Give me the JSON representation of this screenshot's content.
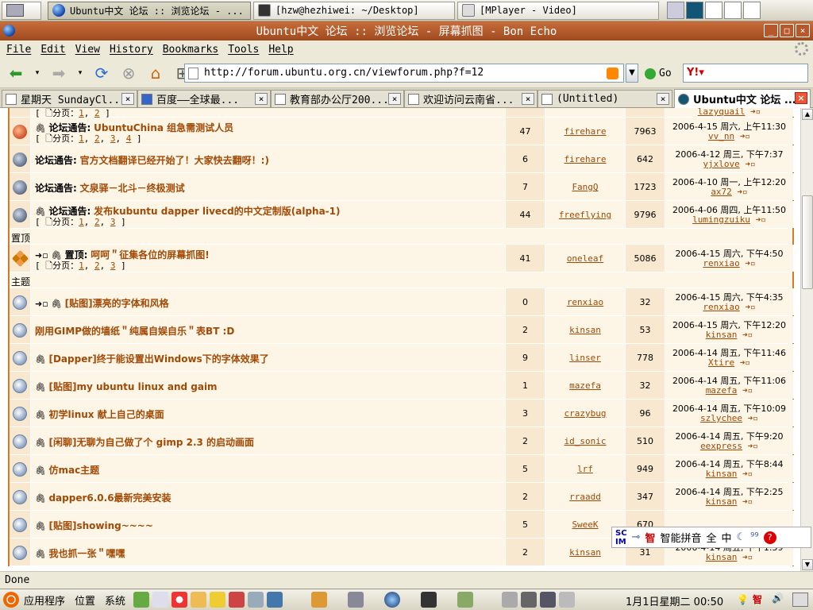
{
  "taskbar_top": {
    "windows": [
      "Ubuntu中文 论坛 :: 浏览论坛 - ...",
      "[hzw@hezhiwei: ~/Desktop]",
      "[MPlayer - Video]"
    ]
  },
  "window": {
    "title": "Ubuntu中文 论坛 :: 浏览论坛 - 屏幕抓图 - Bon Echo"
  },
  "menu": {
    "file": "File",
    "edit": "Edit",
    "view": "View",
    "history": "History",
    "bookmarks": "Bookmarks",
    "tools": "Tools",
    "help": "Help"
  },
  "nav": {
    "url": "http://forum.ubuntu.org.cn/viewforum.php?f=12",
    "go": "Go"
  },
  "tabs": [
    "星期天 SundayCl...",
    "百度——全球最...",
    "教育部办公厅200...",
    "欢迎访问云南省...",
    "(Untitled)",
    "Ubuntu中文 论坛 ..."
  ],
  "labels": {
    "page_prefix": "分页：",
    "sticky_header": "置顶",
    "topic_header": "主题"
  },
  "rows": [
    {
      "kind": "announce",
      "icon": "hot",
      "pre": "论坛通告:",
      "title": "UbuntuChina 组急需测试人员",
      "pages": [
        "1",
        "2",
        "3",
        "4"
      ],
      "replies": "47",
      "author": "firehare",
      "views": "7963",
      "last_date": "2006-4-15 周六, 上午11:30",
      "last_user": "vv_nn"
    },
    {
      "kind": "announce",
      "icon": "globe",
      "pre": "论坛通告:",
      "title": "官方文档翻译已经开始了！大家快去翻呀！:)",
      "pages": [],
      "replies": "6",
      "author": "firehare",
      "views": "642",
      "last_date": "2006-4-12 周三, 下午7:37",
      "last_user": "yjxlove"
    },
    {
      "kind": "announce",
      "icon": "globe",
      "pre": "论坛通告:",
      "title": "文泉驿－北斗－终极测试",
      "pages": [],
      "replies": "7",
      "author": "FangQ",
      "views": "1723",
      "last_date": "2006-4-10 周一, 上午12:20",
      "last_user": "ax72"
    },
    {
      "kind": "announce",
      "icon": "globe",
      "pre": "论坛通告:",
      "title": "发布kubuntu dapper livecd的中文定制版(alpha-1)",
      "pages": [
        "1",
        "2",
        "3"
      ],
      "replies": "44",
      "author": "freeflying",
      "views": "9796",
      "last_date": "2006-4-06 周四, 上午11:50",
      "last_user": "lumingzuiku"
    },
    {
      "kind": "header",
      "label": "置顶"
    },
    {
      "kind": "sticky",
      "icon": "sticky",
      "pre": "置顶:",
      "title": "呵呵＂征集各位的屏幕抓图!",
      "pages": [
        "1",
        "2",
        "3"
      ],
      "replies": "41",
      "author": "oneleaf",
      "views": "5086",
      "last_date": "2006-4-15 周六, 下午4:50",
      "last_user": "renxiao"
    },
    {
      "kind": "header",
      "label": "主题"
    },
    {
      "kind": "topic",
      "icon": "doc",
      "title": "[贴图]漂亮的字体和风格",
      "pages": [],
      "replies": "0",
      "author": "renxiao",
      "views": "32",
      "last_date": "2006-4-15 周六, 下午4:35",
      "last_user": "renxiao"
    },
    {
      "kind": "topic",
      "icon": "doc",
      "title": "刚用GIMP做的墙纸＂纯属自娱自乐＂表BT :D",
      "pages": [],
      "replies": "2",
      "author": "kinsan",
      "views": "53",
      "last_date": "2006-4-15 周六, 下午12:20",
      "last_user": "kinsan"
    },
    {
      "kind": "topic",
      "icon": "doc",
      "title": "[Dapper]终于能设置出Windows下的字体效果了",
      "pages": [],
      "replies": "9",
      "author": "linser",
      "views": "778",
      "last_date": "2006-4-14 周五, 下午11:46",
      "last_user": "Xtire"
    },
    {
      "kind": "topic",
      "icon": "doc",
      "title": "[贴图]my ubuntu linux and gaim",
      "pages": [],
      "replies": "1",
      "author": "mazefa",
      "views": "32",
      "last_date": "2006-4-14 周五, 下午11:06",
      "last_user": "mazefa"
    },
    {
      "kind": "topic",
      "icon": "doc",
      "title": "初学linux 献上自己的桌面",
      "pages": [],
      "replies": "3",
      "author": "crazybug",
      "views": "96",
      "last_date": "2006-4-14 周五, 下午10:09",
      "last_user": "szlychee"
    },
    {
      "kind": "topic",
      "icon": "doc",
      "title": "[闲聊]无聊为自己做了个 gimp 2.3 的启动画面",
      "pages": [],
      "replies": "2",
      "author": "id_sonic",
      "views": "510",
      "last_date": "2006-4-14 周五, 下午9:20",
      "last_user": "eexpress"
    },
    {
      "kind": "topic",
      "icon": "doc",
      "title": "仿mac主题",
      "pages": [],
      "replies": "5",
      "author": "lrf",
      "views": "949",
      "last_date": "2006-4-14 周五, 下午8:44",
      "last_user": "kinsan"
    },
    {
      "kind": "topic",
      "icon": "doc",
      "title": "dapper6.0.6最新完美安装",
      "pages": [],
      "replies": "2",
      "author": "rraadd",
      "views": "347",
      "last_date": "2006-4-14 周五, 下午2:25",
      "last_user": "kinsan"
    },
    {
      "kind": "topic",
      "icon": "doc",
      "title": "[贴图]showing~~~~",
      "pages": [],
      "replies": "5",
      "author": "SweeK",
      "views": "670",
      "last_date": "",
      "last_user": ""
    },
    {
      "kind": "topic",
      "icon": "doc",
      "title": "我也抓一张＂嘿嘿",
      "pages": [],
      "replies": "2",
      "author": "kinsan",
      "views": "31",
      "last_date": "2006-4-14 周五, 下午1:59",
      "last_user": "kinsan"
    }
  ],
  "partial_top": {
    "pages": [
      "1",
      "2"
    ],
    "last_user": "lazyquail"
  },
  "status": {
    "text": "Done"
  },
  "ime": {
    "name": "智能拼音",
    "mode": "全",
    "lang": "中"
  },
  "panel": {
    "apps": "应用程序",
    "places": "位置",
    "system": "系统",
    "clock": "1月1日星期二 00:50"
  }
}
